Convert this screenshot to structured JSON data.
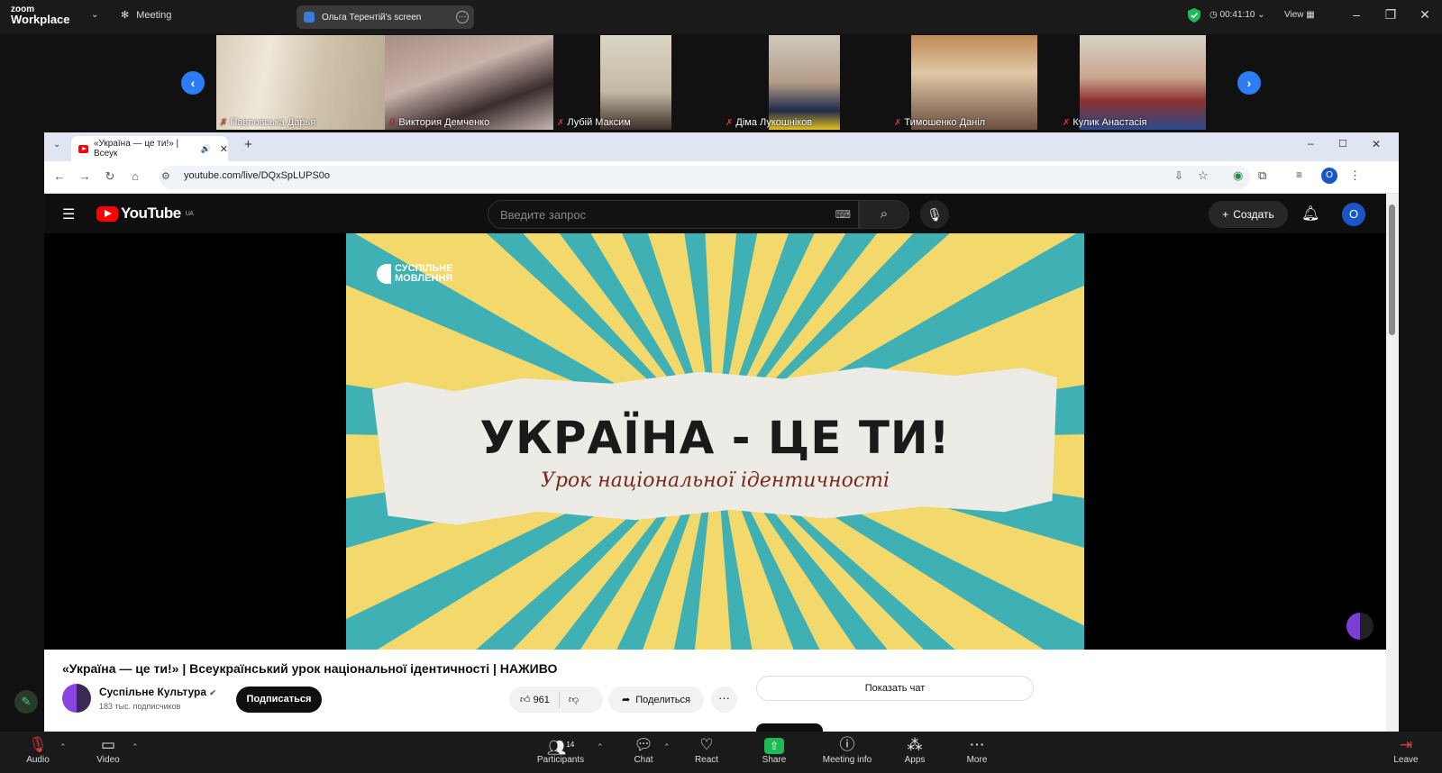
{
  "zoom": {
    "brand_top": "zoom",
    "brand_bottom": "Workplace",
    "meeting_label": "Meeting",
    "share_label": "Ольга Терентій's screen",
    "timer": "00:41:10",
    "view_label": "View",
    "colors": {
      "accent": "#2d7cf6",
      "secure": "#1fb85a",
      "share": "#1db954",
      "muted": "#e03a3a"
    }
  },
  "participants": [
    {
      "name": "Павловська Дарья"
    },
    {
      "name": "Виктория Демченко"
    },
    {
      "name": "Лубій Максим"
    },
    {
      "name": "Діма Лукошніков"
    },
    {
      "name": "Тимошенко Даніл"
    },
    {
      "name": "Кулик Анастасія"
    }
  ],
  "browser": {
    "tab_title": "«Україна — це ти!» | Всеук",
    "url": "youtube.com/live/DQxSpLUPS0o",
    "profile_initial": "O"
  },
  "youtube": {
    "logo": "YouTube",
    "region": "UA",
    "search_placeholder": "Введите запрос",
    "create_label": "Создать",
    "avatar_initial": "O",
    "video_brand": "СУСПІЛЬНЕ МОВЛЕННЯ",
    "video_headline": "УКРАЇНА - ЦЕ ТИ!",
    "video_subline": "Урок національної ідентичності",
    "title": "«Україна — це ти!» | Всеукраїнський урок національної ідентичності | НАЖИВО",
    "channel": "Суспільне Культура",
    "subscribers": "183 тыс. подписчиков",
    "subscribe_label": "Подписаться",
    "likes": "961",
    "share_label": "Поделиться",
    "show_chat": "Показать чат"
  },
  "toolbar": {
    "audio": "Audio",
    "video": "Video",
    "participants": "Participants",
    "participants_count": "14",
    "chat": "Chat",
    "react": "React",
    "share": "Share",
    "meeting_info": "Meeting info",
    "apps": "Apps",
    "more": "More",
    "leave": "Leave"
  }
}
